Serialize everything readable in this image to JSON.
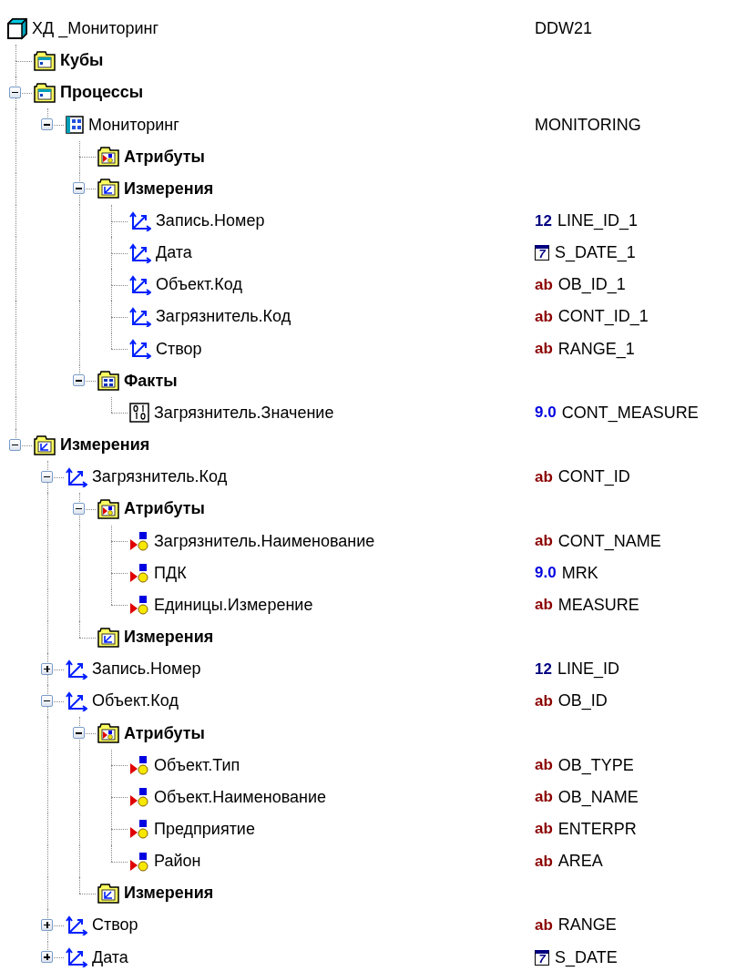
{
  "tree": {
    "label": "ХД _Мониторинг",
    "kind": "cube",
    "field": "DDW21",
    "children": [
      {
        "label": "Кубы",
        "kind": "folder-cube"
      },
      {
        "label": "Процессы",
        "kind": "folder-cube",
        "expanded": true,
        "children": [
          {
            "label": "Мониторинг",
            "kind": "process",
            "expanded": true,
            "field": "MONITORING",
            "children": [
              {
                "label": "Атрибуты",
                "kind": "folder-attr"
              },
              {
                "label": "Измерения",
                "kind": "folder-dim",
                "expanded": true,
                "children": [
                  {
                    "label": "Запись.Номер",
                    "kind": "dim",
                    "type": {
                      "kind": "int",
                      "label": "12"
                    },
                    "field": "LINE_ID_1"
                  },
                  {
                    "label": "Дата",
                    "kind": "dim",
                    "type": {
                      "kind": "date",
                      "label": "7"
                    },
                    "field": "S_DATE_1"
                  },
                  {
                    "label": "Объект.Код",
                    "kind": "dim",
                    "type": {
                      "kind": "string",
                      "label": "ab"
                    },
                    "field": "OB_ID_1"
                  },
                  {
                    "label": "Загрязнитель.Код",
                    "kind": "dim",
                    "type": {
                      "kind": "string",
                      "label": "ab"
                    },
                    "field": "CONT_ID_1"
                  },
                  {
                    "label": "Створ",
                    "kind": "dim",
                    "type": {
                      "kind": "string",
                      "label": "ab"
                    },
                    "field": "RANGE_1"
                  }
                ]
              },
              {
                "label": "Факты",
                "kind": "folder-fact",
                "expanded": true,
                "children": [
                  {
                    "label": "Загрязнитель.Значение",
                    "kind": "fact",
                    "type": {
                      "kind": "float",
                      "label": "9.0"
                    },
                    "field": "CONT_MEASURE"
                  }
                ]
              }
            ]
          }
        ]
      },
      {
        "label": "Измерения",
        "kind": "folder-dim",
        "expanded": true,
        "children": [
          {
            "label": "Загрязнитель.Код",
            "kind": "dim",
            "expanded": true,
            "type": {
              "kind": "string",
              "label": "ab"
            },
            "field": "CONT_ID",
            "children": [
              {
                "label": "Атрибуты",
                "kind": "folder-attr",
                "expanded": true,
                "children": [
                  {
                    "label": "Загрязнитель.Наименование",
                    "kind": "attr",
                    "type": {
                      "kind": "string",
                      "label": "ab"
                    },
                    "field": "CONT_NAME"
                  },
                  {
                    "label": "ПДК",
                    "kind": "attr",
                    "type": {
                      "kind": "float",
                      "label": "9.0"
                    },
                    "field": "MRK"
                  },
                  {
                    "label": "Единицы.Измерение",
                    "kind": "attr",
                    "type": {
                      "kind": "string",
                      "label": "ab"
                    },
                    "field": "MEASURE"
                  }
                ]
              },
              {
                "label": "Измерения",
                "kind": "folder-dim"
              }
            ]
          },
          {
            "label": "Запись.Номер",
            "kind": "dim",
            "expanded": false,
            "type": {
              "kind": "int",
              "label": "12"
            },
            "field": "LINE_ID"
          },
          {
            "label": "Объект.Код",
            "kind": "dim",
            "expanded": true,
            "type": {
              "kind": "string",
              "label": "ab"
            },
            "field": "OB_ID",
            "children": [
              {
                "label": "Атрибуты",
                "kind": "folder-attr",
                "expanded": true,
                "children": [
                  {
                    "label": "Объект.Тип",
                    "kind": "attr",
                    "type": {
                      "kind": "string",
                      "label": "ab"
                    },
                    "field": "OB_TYPE"
                  },
                  {
                    "label": "Объект.Наименование",
                    "kind": "attr",
                    "type": {
                      "kind": "string",
                      "label": "ab"
                    },
                    "field": "OB_NAME"
                  },
                  {
                    "label": "Предприятие",
                    "kind": "attr",
                    "type": {
                      "kind": "string",
                      "label": "ab"
                    },
                    "field": "ENTERPR"
                  },
                  {
                    "label": "Район",
                    "kind": "attr",
                    "type": {
                      "kind": "string",
                      "label": "ab"
                    },
                    "field": "AREA"
                  }
                ]
              },
              {
                "label": "Измерения",
                "kind": "folder-dim"
              }
            ]
          },
          {
            "label": "Створ",
            "kind": "dim",
            "expanded": false,
            "type": {
              "kind": "string",
              "label": "ab"
            },
            "field": "RANGE"
          },
          {
            "label": "Дата",
            "kind": "dim",
            "expanded": false,
            "type": {
              "kind": "date",
              "label": "7"
            },
            "field": "S_DATE"
          }
        ]
      }
    ]
  }
}
